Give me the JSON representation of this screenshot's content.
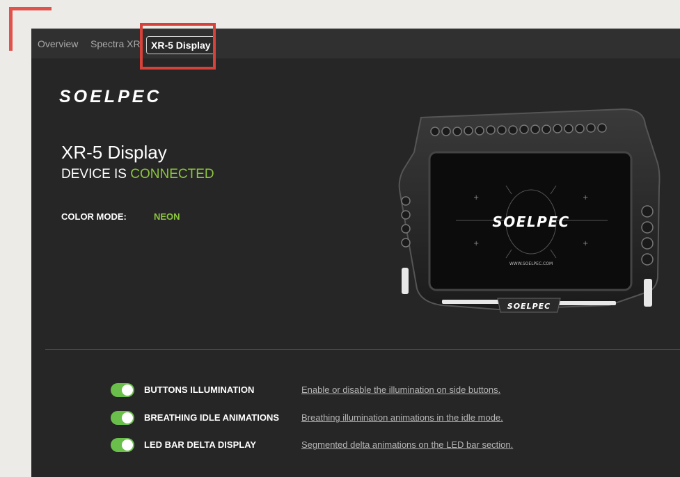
{
  "tabs": {
    "overview": "Overview",
    "spectra": "Spectra XR",
    "active": "XR-5 Display"
  },
  "brand": {
    "logo": "SOELPEC"
  },
  "device": {
    "title": "XR-5 Display",
    "status_prefix": "DEVICE IS ",
    "status_value": "CONNECTED",
    "color_mode_label": "COLOR MODE:",
    "color_mode_value": "NEON",
    "screen_logo": "SOELPEC",
    "screen_url": "WWW.SOELPEC.COM",
    "bezel_logo": "SOELPEC"
  },
  "settings": [
    {
      "label": "BUTTONS ILLUMINATION",
      "description": "Enable or disable the illumination on side buttons.",
      "enabled": true
    },
    {
      "label": "BREATHING IDLE ANIMATIONS",
      "description": "Breathing illumination animations in the idle mode.",
      "enabled": true
    },
    {
      "label": "LED BAR DELTA DISPLAY",
      "description": "Segmented delta animations on the LED bar section.",
      "enabled": true
    }
  ],
  "colors": {
    "accent_green": "#8dc63f",
    "toggle_green": "#6abf4b",
    "highlight_red": "#d6413a",
    "background": "#262626"
  }
}
